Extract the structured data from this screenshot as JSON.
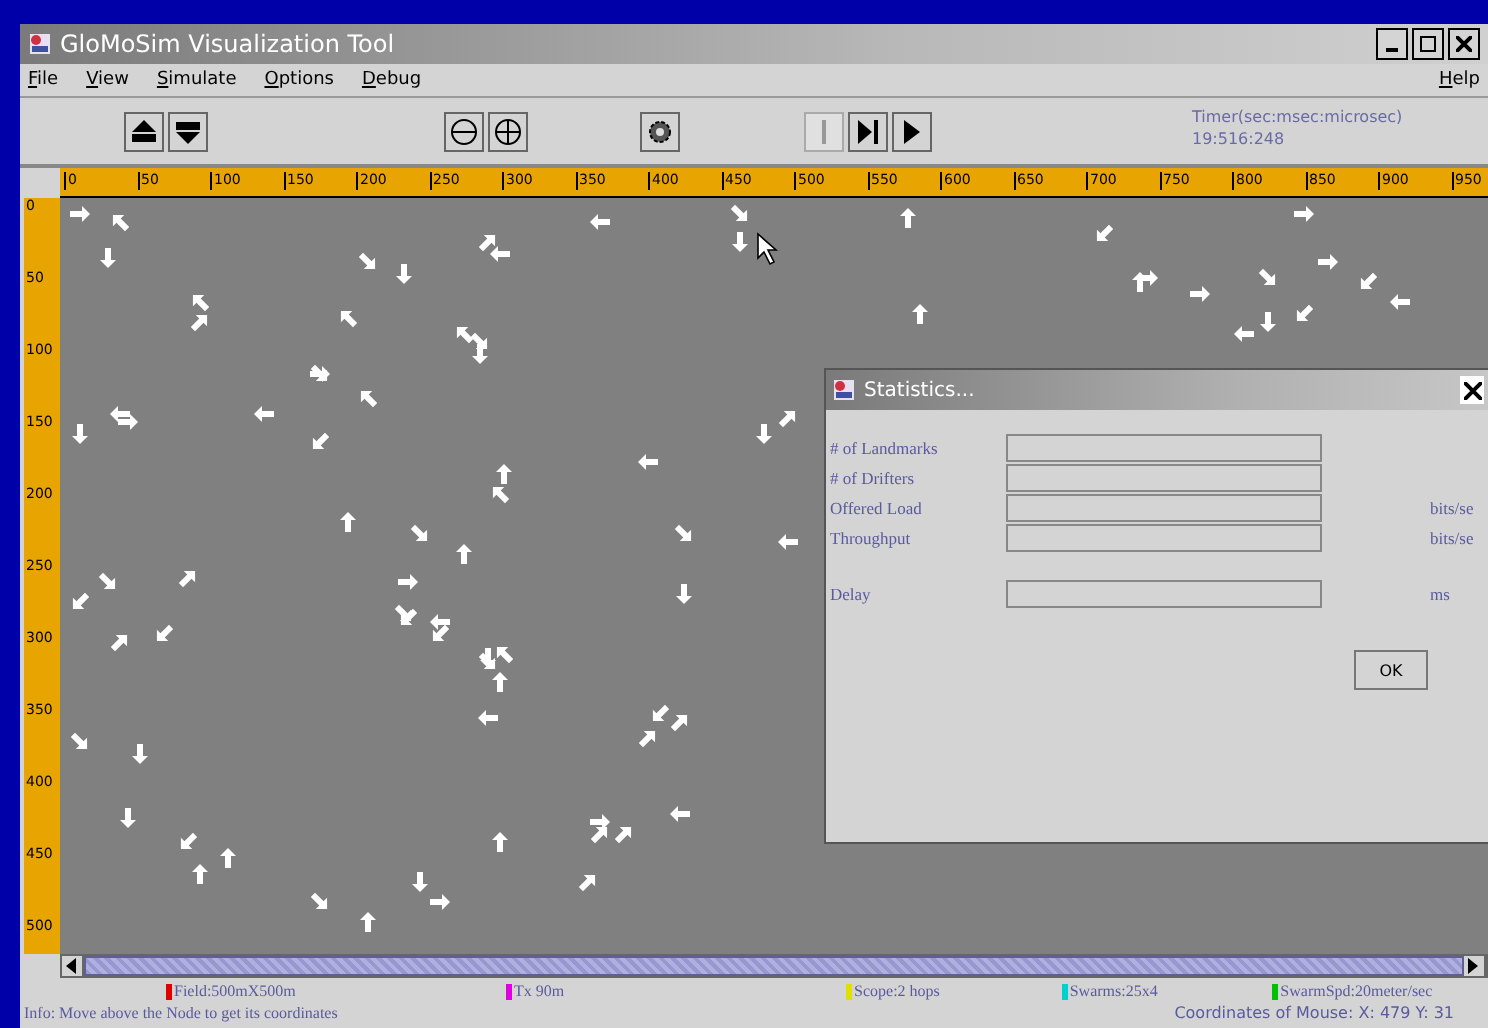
{
  "window": {
    "title": "GloMoSim Visualization Tool"
  },
  "menu": [
    {
      "label": "File"
    },
    {
      "label": "View"
    },
    {
      "label": "Simulate"
    },
    {
      "label": "Options"
    },
    {
      "label": "Debug"
    }
  ],
  "help_menu": {
    "label": "Help"
  },
  "toolbar": [
    {
      "kind": "up",
      "disabled": false
    },
    {
      "kind": "down",
      "disabled": false
    },
    {
      "kind": "zoom-out",
      "disabled": false
    },
    {
      "kind": "zoom-in",
      "disabled": false
    },
    {
      "kind": "gear",
      "disabled": false
    },
    {
      "kind": "pause",
      "disabled": true
    },
    {
      "kind": "step",
      "disabled": false
    },
    {
      "kind": "play",
      "disabled": false
    }
  ],
  "timer": {
    "label": "Timer(sec:msec:microsec)",
    "value": "19:516:248"
  },
  "ruler": {
    "x_ticks": [
      "0",
      "50",
      "100",
      "150",
      "200",
      "250",
      "300",
      "350",
      "400",
      "450",
      "500",
      "550",
      "600",
      "650",
      "700",
      "750",
      "800",
      "850",
      "900",
      "950"
    ],
    "y_ticks": [
      "0",
      "50",
      "100",
      "150",
      "200",
      "250",
      "300",
      "350",
      "400",
      "450",
      "500"
    ]
  },
  "legend": [
    {
      "label": "Field:500mX500m",
      "color": "#e00000"
    },
    {
      "label": "Tx 90m",
      "color": "#e000e0"
    },
    {
      "label": "Scope:2 hops",
      "color": "#e0e000"
    },
    {
      "label": "Swarms:25x4",
      "color": "#00d0d0"
    },
    {
      "label": "SwarmSpd:20meter/sec",
      "color": "#00c000"
    }
  ],
  "info": "Info: Move above the Node to get its coordinates",
  "mouse": "Coordinates of Mouse: X: 479 Y: 31",
  "dialog": {
    "title": "Statistics...",
    "rows": [
      {
        "label": "# of Landmarks",
        "unit": ""
      },
      {
        "label": "# of Drifters",
        "unit": ""
      },
      {
        "label": "Offered Load",
        "unit": "bits/se"
      },
      {
        "label": "Throughput",
        "unit": "bits/se"
      },
      {
        "label": "Delay",
        "unit": "ms"
      }
    ],
    "ok": "OK"
  }
}
